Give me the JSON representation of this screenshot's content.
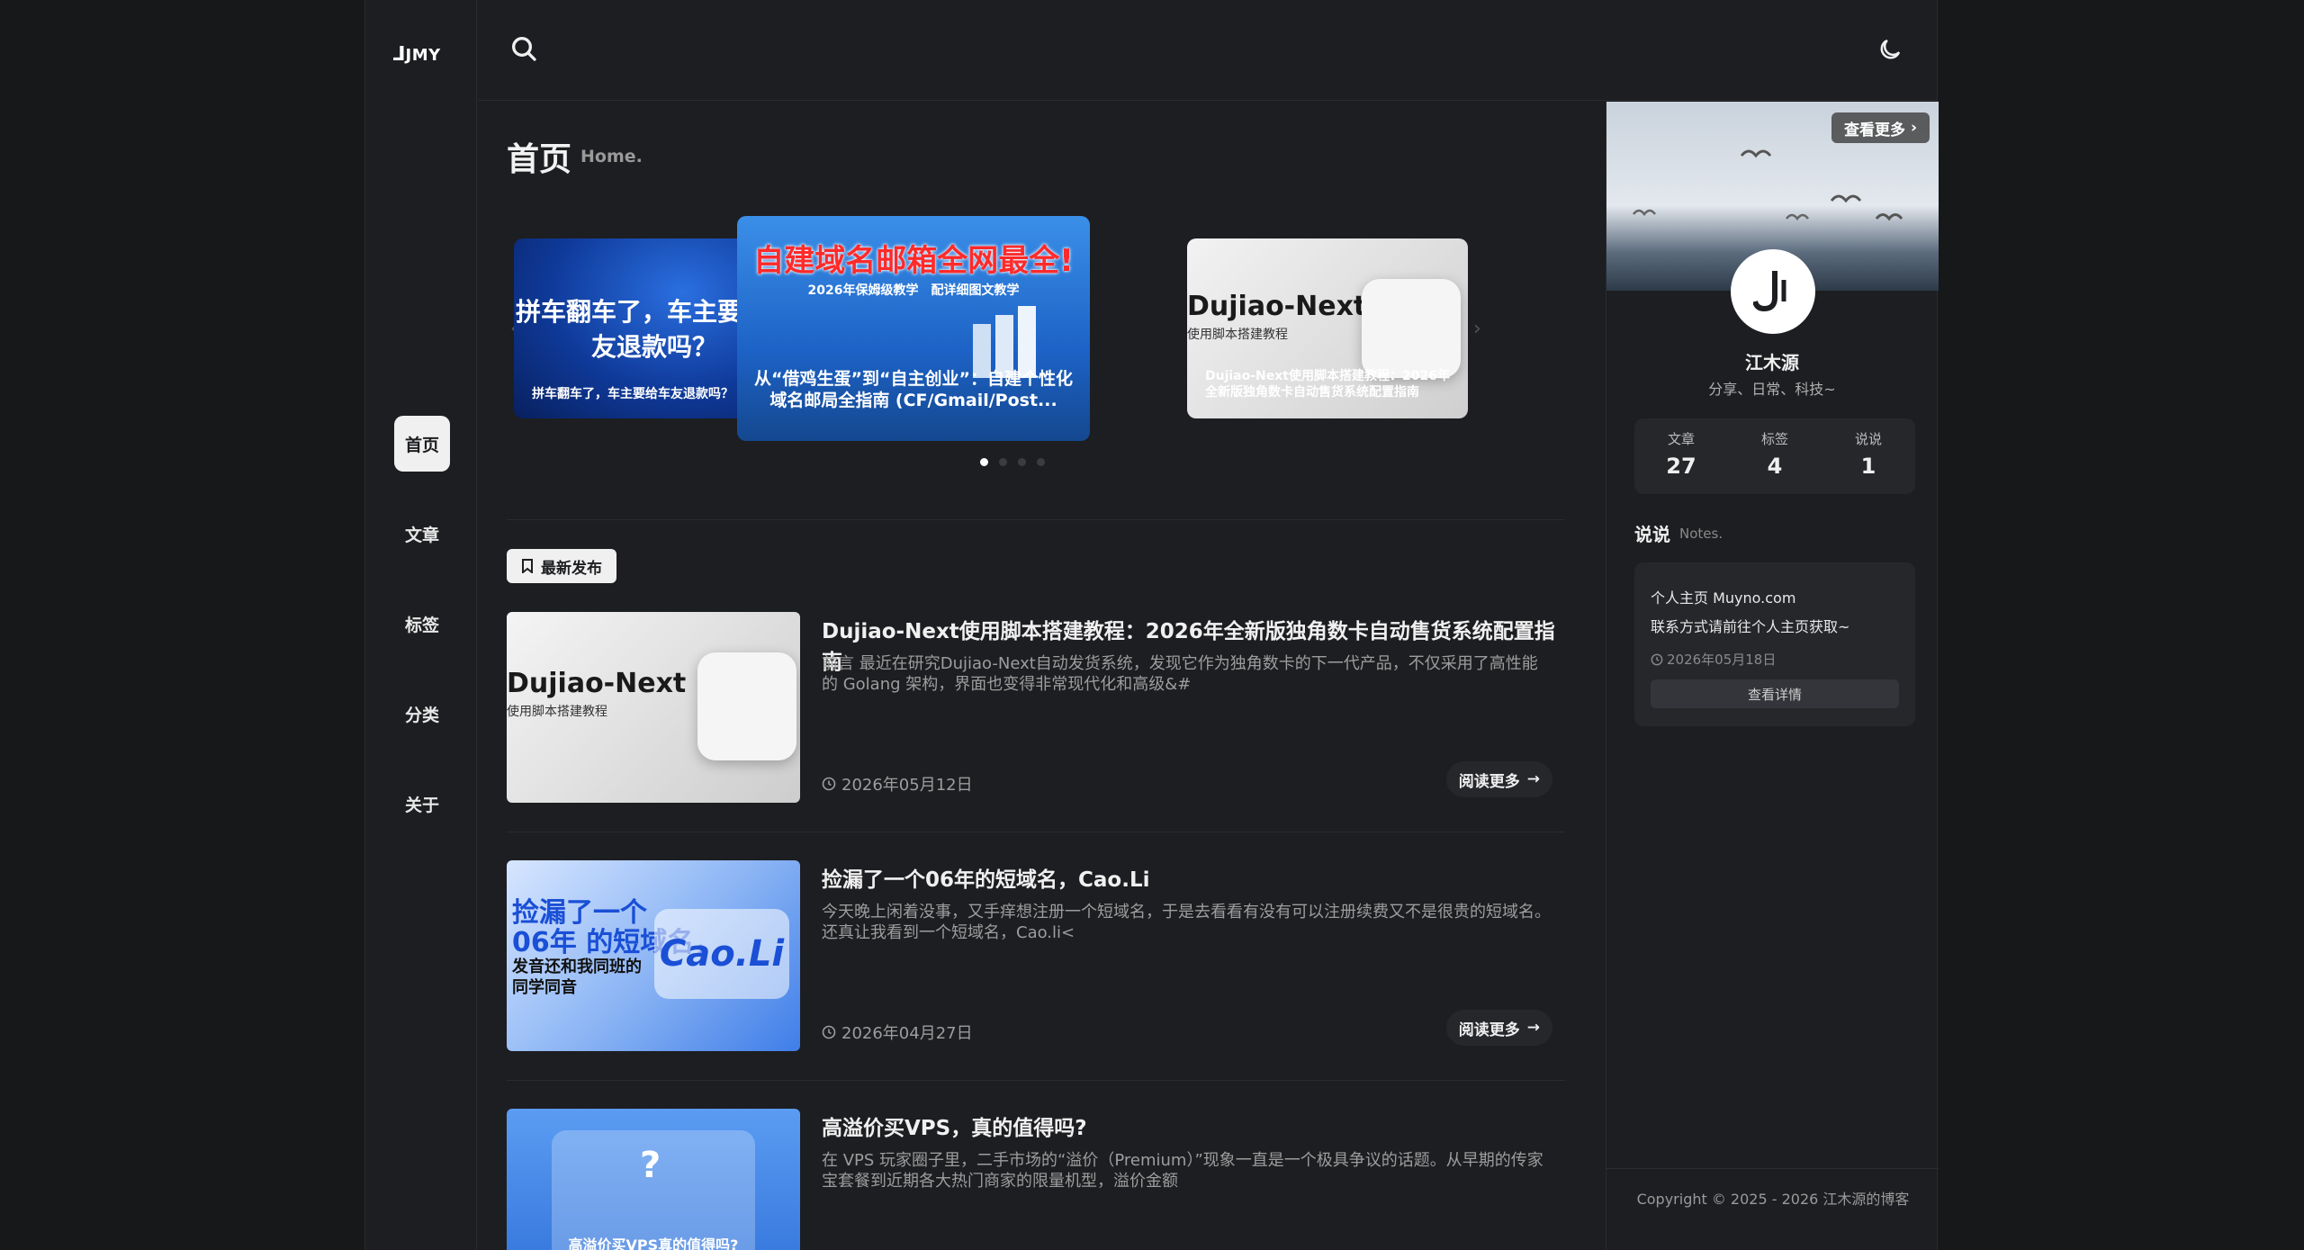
{
  "brand": {
    "logo_text": "JMY"
  },
  "nav": {
    "items": [
      {
        "label": "首页",
        "active": true
      },
      {
        "label": "文章",
        "active": false
      },
      {
        "label": "标签",
        "active": false
      },
      {
        "label": "分类",
        "active": false
      },
      {
        "label": "关于",
        "active": false
      }
    ]
  },
  "header": {
    "search_icon": "search-icon",
    "theme_icon": "moon-icon"
  },
  "page": {
    "title": "首页",
    "subtitle": "Home."
  },
  "carousel": {
    "slides": [
      {
        "big_text": "拼车翻车了，车主要给车友退款吗？",
        "caption": "拼车翻车了，车主要给车友退款吗？"
      },
      {
        "banner": "自建域名邮箱全网最全!",
        "banner_sub": "2026年保姆级教学　配详细图文教学",
        "caption": "从“借鸡生蛋”到“自主创业”：自建个性化域名邮局全指南 (CF/Gmail/Post..."
      },
      {
        "brand": "Dujiao-Next",
        "brand_sub": "使用脚本搭建教程",
        "caption": "Dujiao-Next使用脚本搭建教程：2026年全新版独角数卡自动售货系统配置指南"
      }
    ],
    "active_dot": 0,
    "dot_count": 4
  },
  "latest": {
    "label": "最新发布"
  },
  "posts": [
    {
      "title": "Dujiao-Next使用脚本搭建教程：2026年全新版独角数卡自动售货系统配置指南",
      "excerpt": "前言 最近在研究Dujiao-Next自动发货系统，发现它作为独角数卡的下一代产品，不仅采用了高性能的 Golang 架构，界面也变得非常现代化和高级&#",
      "date": "2026年05月12日",
      "more": "阅读更多",
      "thumb_brand": "Dujiao-Next",
      "thumb_sub": "使用脚本搭建教程"
    },
    {
      "title": "捡漏了一个06年的短域名，Cao.Li",
      "excerpt": "今天晚上闲着没事，又手痒想注册一个短域名，于是去看看有没有可以注册续费又不是很贵的短域名。 还真让我看到一个短域名，Cao.li<",
      "date": "2026年04月27日",
      "more": "阅读更多",
      "thumb_line1": "捡漏了一个",
      "thumb_line2": "06年 的短域名，",
      "thumb_line3": "发音还和我同班的",
      "thumb_line4": "同学同音",
      "thumb_card": "Cao.Li"
    },
    {
      "title": "高溢价买VPS，真的值得吗?",
      "excerpt": "在 VPS 玩家圈子里，二手市场的“溢价（Premium）”现象一直是一个极具争议的话题。从早期的传家宝套餐到近期各大热门商家的限量机型，溢价金额",
      "thumb_text": "高溢价买VPS真的值得吗?"
    }
  ],
  "profile": {
    "view_more": "查看更多",
    "name": "江木源",
    "bio": "分享、日常、科技~",
    "stats": [
      {
        "label": "文章",
        "value": "27"
      },
      {
        "label": "标签",
        "value": "4"
      },
      {
        "label": "说说",
        "value": "1"
      }
    ]
  },
  "notes": {
    "heading": "说说",
    "subheading": "Notes.",
    "line1": "个人主页 Muyno.com",
    "line2": "联系方式请前往个人主页获取~",
    "date": "2026年05月18日",
    "detail": "查看详情"
  },
  "footer": {
    "copyright": "Copyright © 2025 - 2026 江木源的博客"
  },
  "colors": {
    "bg": "#17181a",
    "panel": "#1d1e21",
    "card": "#26272b",
    "accent": "#f0f0f0"
  }
}
